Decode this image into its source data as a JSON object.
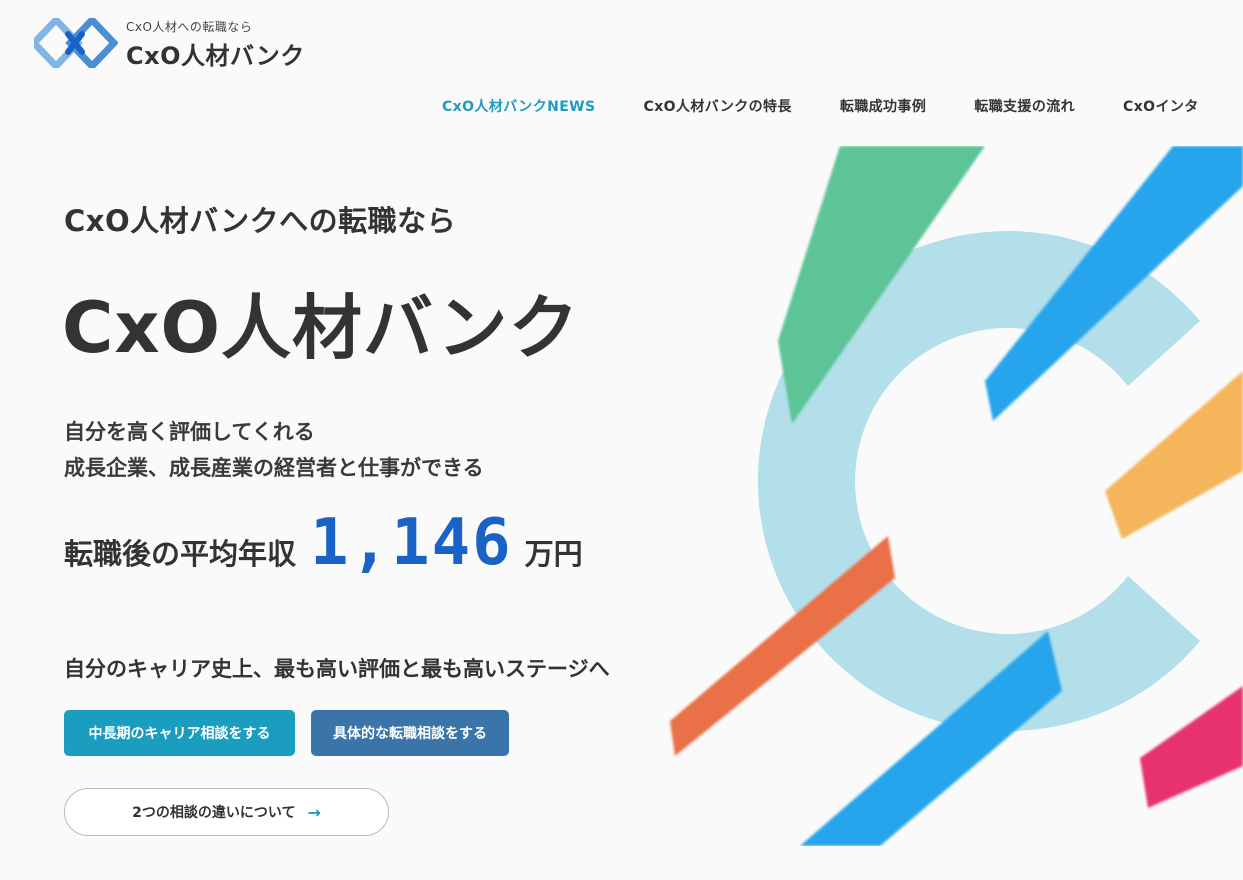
{
  "header": {
    "logo_tagline": "CxO人材への転職なら",
    "logo_name": "CxO人材バンク",
    "nav": [
      {
        "label": "CxO人材バンクNEWS",
        "active": true
      },
      {
        "label": "CxO人材バンクの特長",
        "active": false
      },
      {
        "label": "転職成功事例",
        "active": false
      },
      {
        "label": "転職支援の流れ",
        "active": false
      },
      {
        "label": "CxOインタ",
        "active": false
      }
    ]
  },
  "hero": {
    "eyebrow": "CxO人材バンクへの転職なら",
    "title": "CxO人材バンク",
    "subtitle_line1": "自分を高く評価してくれる",
    "subtitle_line2": "成長企業、成長産業の経営者と仕事ができる",
    "salary_label": "転職後の平均年収",
    "salary_value": "1,146",
    "salary_unit": "万円",
    "tagline": "自分のキャリア史上、最も高い評価と最も高いステージへ",
    "button_career": "中長期のキャリア相談をする",
    "button_consult": "具体的な転職相談をする",
    "button_diff": "2つの相談の違いについて"
  },
  "icons": {
    "logo": "diamond-logo-icon",
    "arrow": "arrow-right-icon"
  },
  "colors": {
    "accent": "#1f9bbf",
    "salary": "#1a63c6",
    "button_career": "#1a9dbf",
    "button_consult": "#3a74a8",
    "ring": "#b3dfea",
    "stripe_green": "#5cc497",
    "stripe_blue": "#26a4ec",
    "stripe_orange": "#f5b55a",
    "stripe_red": "#ea7047",
    "stripe_pink": "#e8336d"
  }
}
